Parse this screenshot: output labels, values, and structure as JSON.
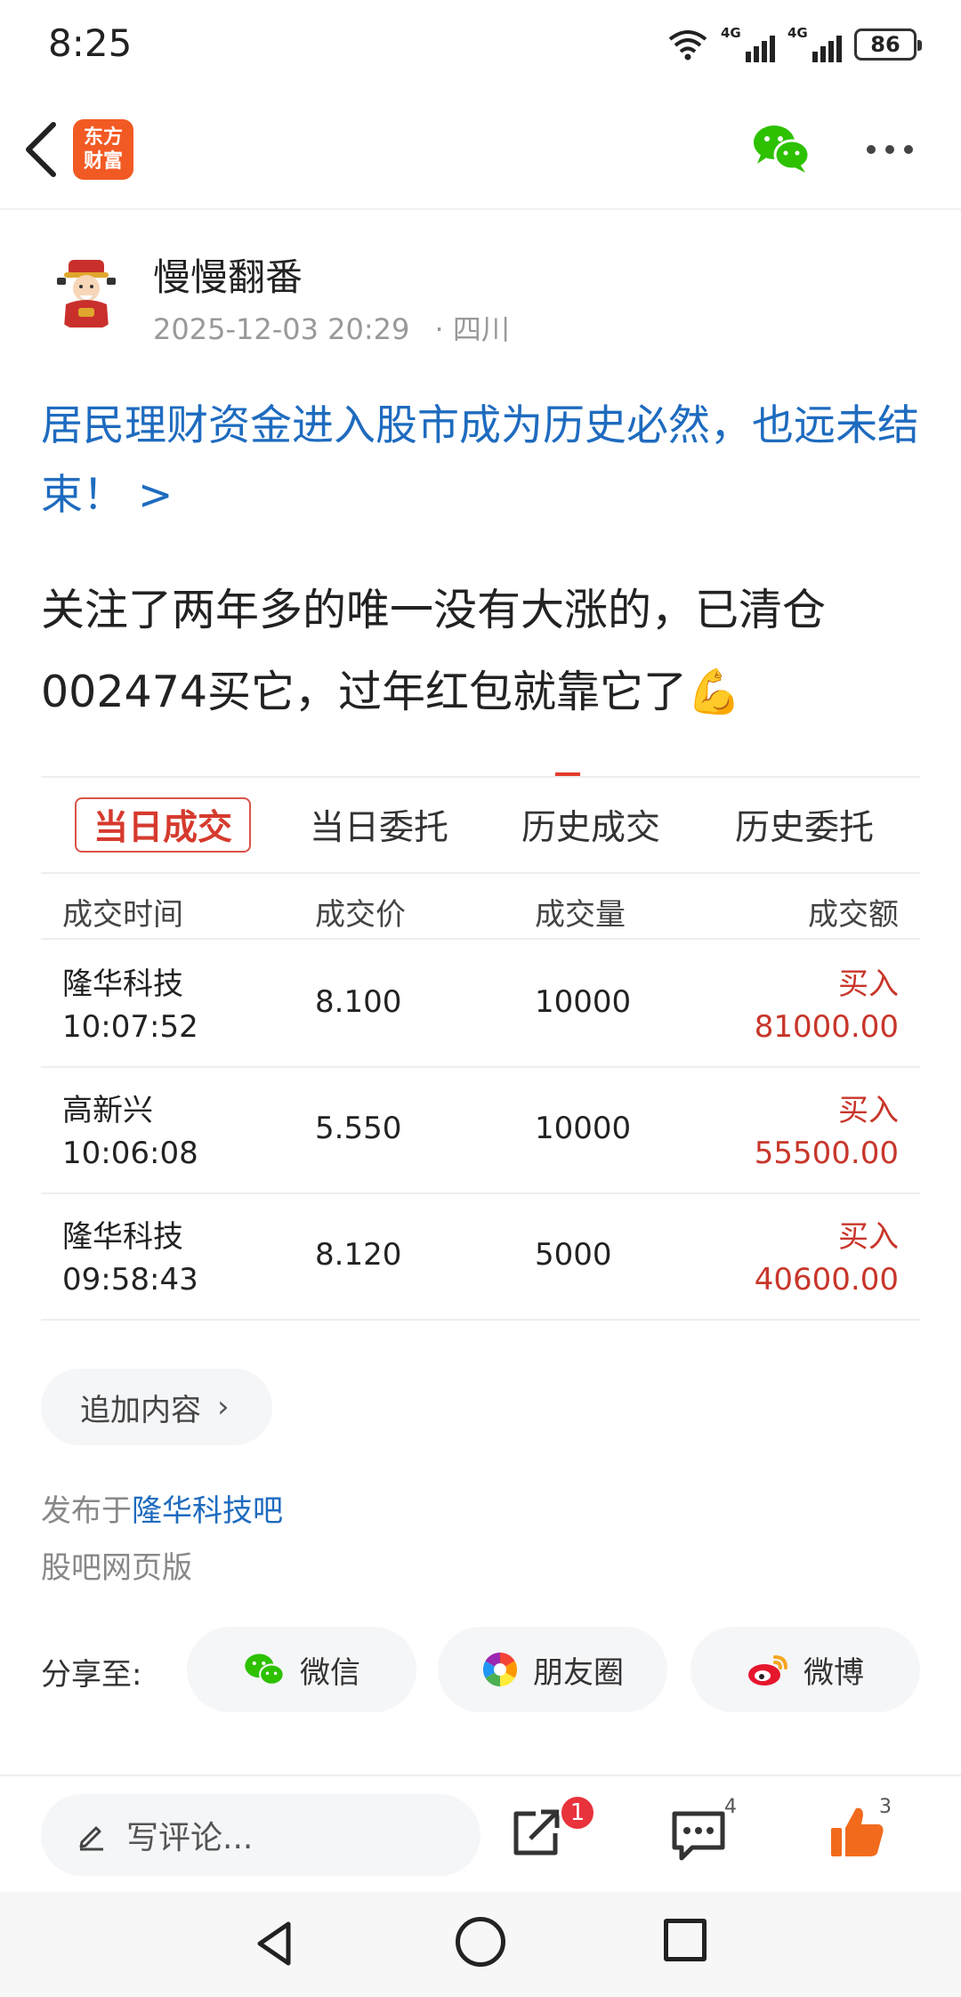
{
  "status_bar": {
    "time": "8:25",
    "network1": "4G",
    "network2": "4G",
    "battery": "86"
  },
  "header": {
    "logo_text": "东方\n财富"
  },
  "post": {
    "author": "慢慢翻番",
    "date": "2025-12-03 20:29",
    "location": "· 四川",
    "title": "居民理财资金进入股市成为历史必然，也远未结束！ >",
    "body": "关注了两年多的唯一没有大涨的，已清仓002474买它，过年红包就靠它了💪"
  },
  "trade": {
    "tabs": [
      "当日成交",
      "当日委托",
      "历史成交",
      "历史委托"
    ],
    "headers": [
      "成交时间",
      "成交价",
      "成交量",
      "成交额"
    ],
    "rows": [
      {
        "name": "隆华科技",
        "time": "10:07:52",
        "price": "8.100",
        "volume": "10000",
        "side": "买入",
        "amount": "81000.00"
      },
      {
        "name": "高新兴",
        "time": "10:06:08",
        "price": "5.550",
        "volume": "10000",
        "side": "买入",
        "amount": "55500.00"
      },
      {
        "name": "隆华科技",
        "time": "09:58:43",
        "price": "8.120",
        "volume": "5000",
        "side": "买入",
        "amount": "40600.00"
      }
    ]
  },
  "add_content": "追加内容",
  "published": {
    "prefix": "发布于",
    "bar": "隆华科技吧"
  },
  "web_version": "股吧网页版",
  "share": {
    "label": "分享至:",
    "wechat": "微信",
    "moments": "朋友圈",
    "weibo": "微博"
  },
  "action_bar": {
    "comment_placeholder": "写评论...",
    "share_badge": "1",
    "comment_count": "4",
    "like_count": "3"
  },
  "colors": {
    "link": "#1e6bbf",
    "accent_red": "#d63a2e",
    "logo_orange": "#f25a24",
    "like_orange": "#f26b1d",
    "wechat_green": "#2dc100"
  }
}
